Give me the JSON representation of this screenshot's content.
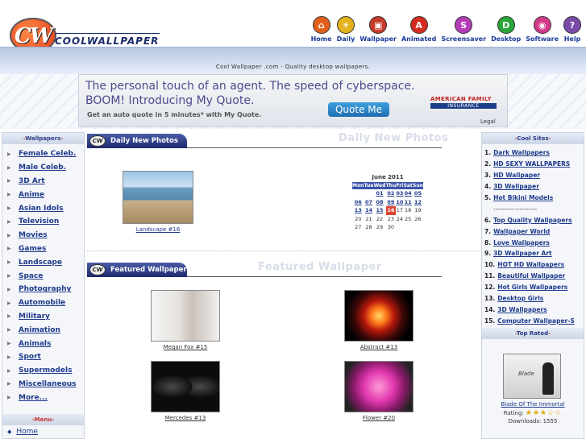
{
  "site": {
    "logo_letters": "CW",
    "logo_word": "COOLWALLPAPER",
    "tagline": "Cool Wallpaper .com - Quality desktop wallpapers."
  },
  "nav": [
    {
      "label": "Home",
      "icon": "house-icon",
      "glyph": "⌂",
      "color": "#e2601c"
    },
    {
      "label": "Daily",
      "icon": "sun-icon",
      "glyph": "☀",
      "color": "#e2b21c"
    },
    {
      "label": "Wallpaper",
      "icon": "picture-icon",
      "glyph": "▣",
      "color": "#c83a2a"
    },
    {
      "label": "Animated",
      "icon": "letter-a-icon",
      "glyph": "A",
      "color": "#d42b20"
    },
    {
      "label": "Screensaver",
      "icon": "letter-s-icon",
      "glyph": "S",
      "color": "#b43cb8"
    },
    {
      "label": "Desktop",
      "icon": "letter-d-icon",
      "glyph": "D",
      "color": "#2aa63a"
    },
    {
      "label": "Software",
      "icon": "disc-icon",
      "glyph": "◉",
      "color": "#d23a8a"
    },
    {
      "label": "Help",
      "icon": "question-icon",
      "glyph": "?",
      "color": "#7a4aa8"
    }
  ],
  "banner": {
    "line1": "The personal touch of an agent. The speed of cyberspace.",
    "line2": "BOOM! Introducing My Quote.",
    "line3": "Get an auto quote in 5 minutes* with My Quote.",
    "button": "Quote Me",
    "brand1": "AMERICAN FAMILY",
    "brand2": "INSURANCE",
    "legal": "Legal"
  },
  "left": {
    "heading": "Wallpapers",
    "items": [
      "Female Celeb.",
      "Male Celeb.",
      "3D Art",
      "Anime",
      "Asian Idols",
      "Television",
      "Movies",
      "Games",
      "Landscape",
      "Space",
      "Photography",
      "Automobile",
      "Military",
      "Animation",
      "Animals",
      "Sport",
      "Supermodels",
      "Miscellaneous",
      "More..."
    ],
    "menu_heading": "Menu",
    "menu_home": "Home"
  },
  "daily": {
    "tab": "Daily New Photos",
    "ghost": "Daily New Photos",
    "photo_caption": "Landscape #16"
  },
  "calendar": {
    "title": "June 2011",
    "days": [
      "Mon",
      "Tue",
      "Wed",
      "Thu",
      "Fri",
      "Sat",
      "Sun"
    ],
    "weeks": [
      [
        "",
        "",
        "01",
        "02",
        "03",
        "04",
        "05"
      ],
      [
        "06",
        "07",
        "08",
        "09",
        "10",
        "11",
        "12"
      ],
      [
        "13",
        "14",
        "15",
        "16",
        "17",
        "18",
        "19"
      ],
      [
        "20",
        "21",
        "22",
        "23",
        "24",
        "25",
        "26"
      ],
      [
        "27",
        "28",
        "29",
        "30",
        "",
        "",
        ""
      ]
    ],
    "linked_through": "16",
    "today": "16"
  },
  "featured": {
    "tab": "Featured Wallpaper",
    "ghost": "Featured Wallpaper",
    "items": [
      {
        "caption": "Megan Fox #15"
      },
      {
        "caption": "Abstract #13"
      },
      {
        "caption": "Mercedes #13"
      },
      {
        "caption": "Flower #20"
      }
    ]
  },
  "right": {
    "heading": "Cool Sites",
    "items_a": [
      "Dark Wallpapers",
      "HD SEXY WALLPAPERS",
      "HD Wallpaper",
      "3D Wallpaper",
      "Hot Bikini Models"
    ],
    "separator": "--------------------",
    "items_b": [
      "Top Quality Wallpapers",
      "Wallpaper World",
      "Love Wallpapers",
      "3D Wallpaper Art",
      "HOT HD Wallpapers",
      "Beautiful Wallpaper",
      "Hot Girls Wallpapers",
      "Desktop Girls",
      "3D Wallpapers",
      "Computer Wallpaper-S"
    ],
    "top_heading": "Top Rated",
    "top_thumb_text": "Blade",
    "top_name": "Blade Of The Immortal",
    "rating_label": "Rating:",
    "rating_stars": "★★★☆☆",
    "downloads": "Downloads: 1555"
  }
}
